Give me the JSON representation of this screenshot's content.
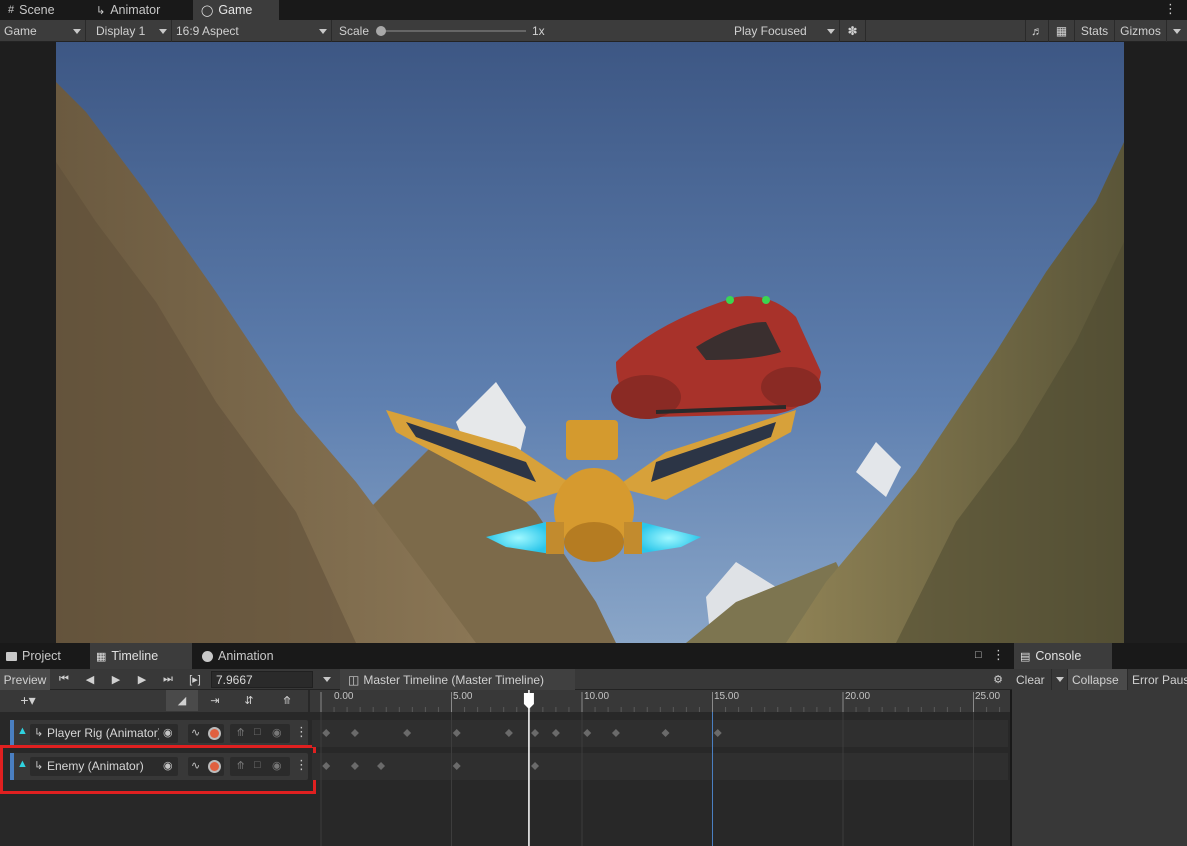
{
  "top_tabs": [
    {
      "label": "Scene",
      "icon": "grid-icon"
    },
    {
      "label": "Animator",
      "icon": "animator-icon"
    },
    {
      "label": "Game",
      "icon": "gamepad-icon",
      "active": true
    }
  ],
  "game_toolbar": {
    "display_mode": "Game",
    "display": "Display 1",
    "aspect": "16:9 Aspect",
    "scale_label": "Scale",
    "scale_value": "1x",
    "play_mode": "Play Focused",
    "stats": "Stats",
    "gizmos": "Gizmos"
  },
  "bottom_tabs": [
    {
      "label": "Project",
      "icon": "folder-icon"
    },
    {
      "label": "Timeline",
      "icon": "film-icon",
      "active": true
    },
    {
      "label": "Animation",
      "icon": "clock-icon"
    }
  ],
  "console": {
    "tab": "Console",
    "clear": "Clear",
    "collapse": "Collapse",
    "error_pause": "Error Pause"
  },
  "timeline": {
    "preview": "Preview",
    "frame_value": "7.9667",
    "asset_name": "Master Timeline (Master Timeline)",
    "playhead_time": 7.9667,
    "ruler_labels": [
      "0.00",
      "5.00",
      "10.00",
      "15.00",
      "20.00",
      "25.00"
    ],
    "tracks": [
      {
        "name": "Player Rig (Animator)",
        "keyframes": [
          0.2,
          1.3,
          3.3,
          5.2,
          7.2,
          8.2,
          9.0,
          10.2,
          11.3,
          13.2,
          15.2
        ]
      },
      {
        "name": "Enemy (Animator)",
        "keyframes": [
          0.2,
          1.3,
          2.3,
          5.2,
          8.2
        ],
        "highlighted": true
      }
    ]
  },
  "colors": {
    "highlight": "#e02020",
    "record": "#e06040",
    "playhead": "#ffffff",
    "track_accent": "#4a7fc1"
  }
}
